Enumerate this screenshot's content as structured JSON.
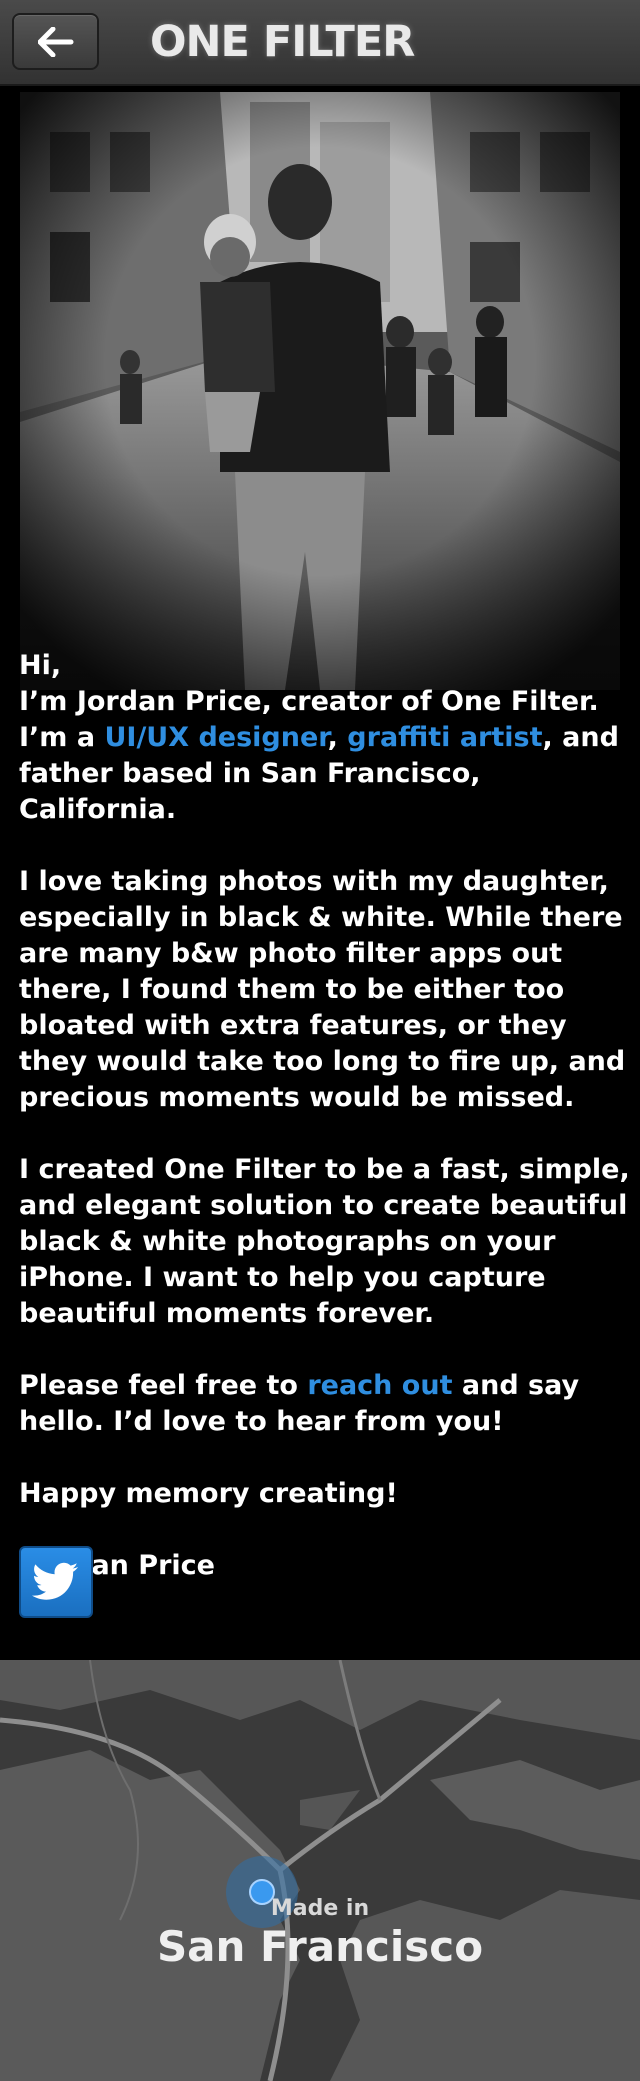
{
  "header": {
    "title": "ONE FILTER",
    "back_icon": "arrow-left-icon"
  },
  "photo": {
    "description_icon": "photo"
  },
  "about": {
    "greeting": "Hi,",
    "intro_prefix": "I’m Jordan Price, creator of One Filter. I’m a ",
    "link_designer": "UI/UX designer",
    "intro_comma": ", ",
    "link_graffiti": "graffiti artist",
    "intro_suffix": ", and father based in San Francisco, California.",
    "paragraph_2": "I love taking photos with my daughter, especially in black & white. While there are many b&w photo filter apps out there, I found them to be either too bloated with extra features, or they they would take too long to fire up, and precious moments would be missed.",
    "paragraph_3": "I created One Filter to be a fast, simple, and elegant solution to create beautiful black & white photographs on your iPhone. I want to help you capture beautiful moments forever.",
    "contact_prefix": "Please feel free to ",
    "link_contact": "reach out",
    "contact_suffix": " and say hello. I’d love to hear from you!",
    "closing": "Happy memory creating!",
    "signature": "-Jordan Price"
  },
  "social": {
    "twitter_icon": "twitter-bird-icon"
  },
  "map": {
    "made_in": "Made in",
    "city": "San Francisco"
  },
  "colors": {
    "link": "#2f8ee0",
    "twitter": "#2a8de6",
    "background": "#000000",
    "header": "#3f3f3f",
    "map_water": "#3a3a3a",
    "map_land": "#5a5a5a",
    "location_dot": "#2f8ee0"
  }
}
